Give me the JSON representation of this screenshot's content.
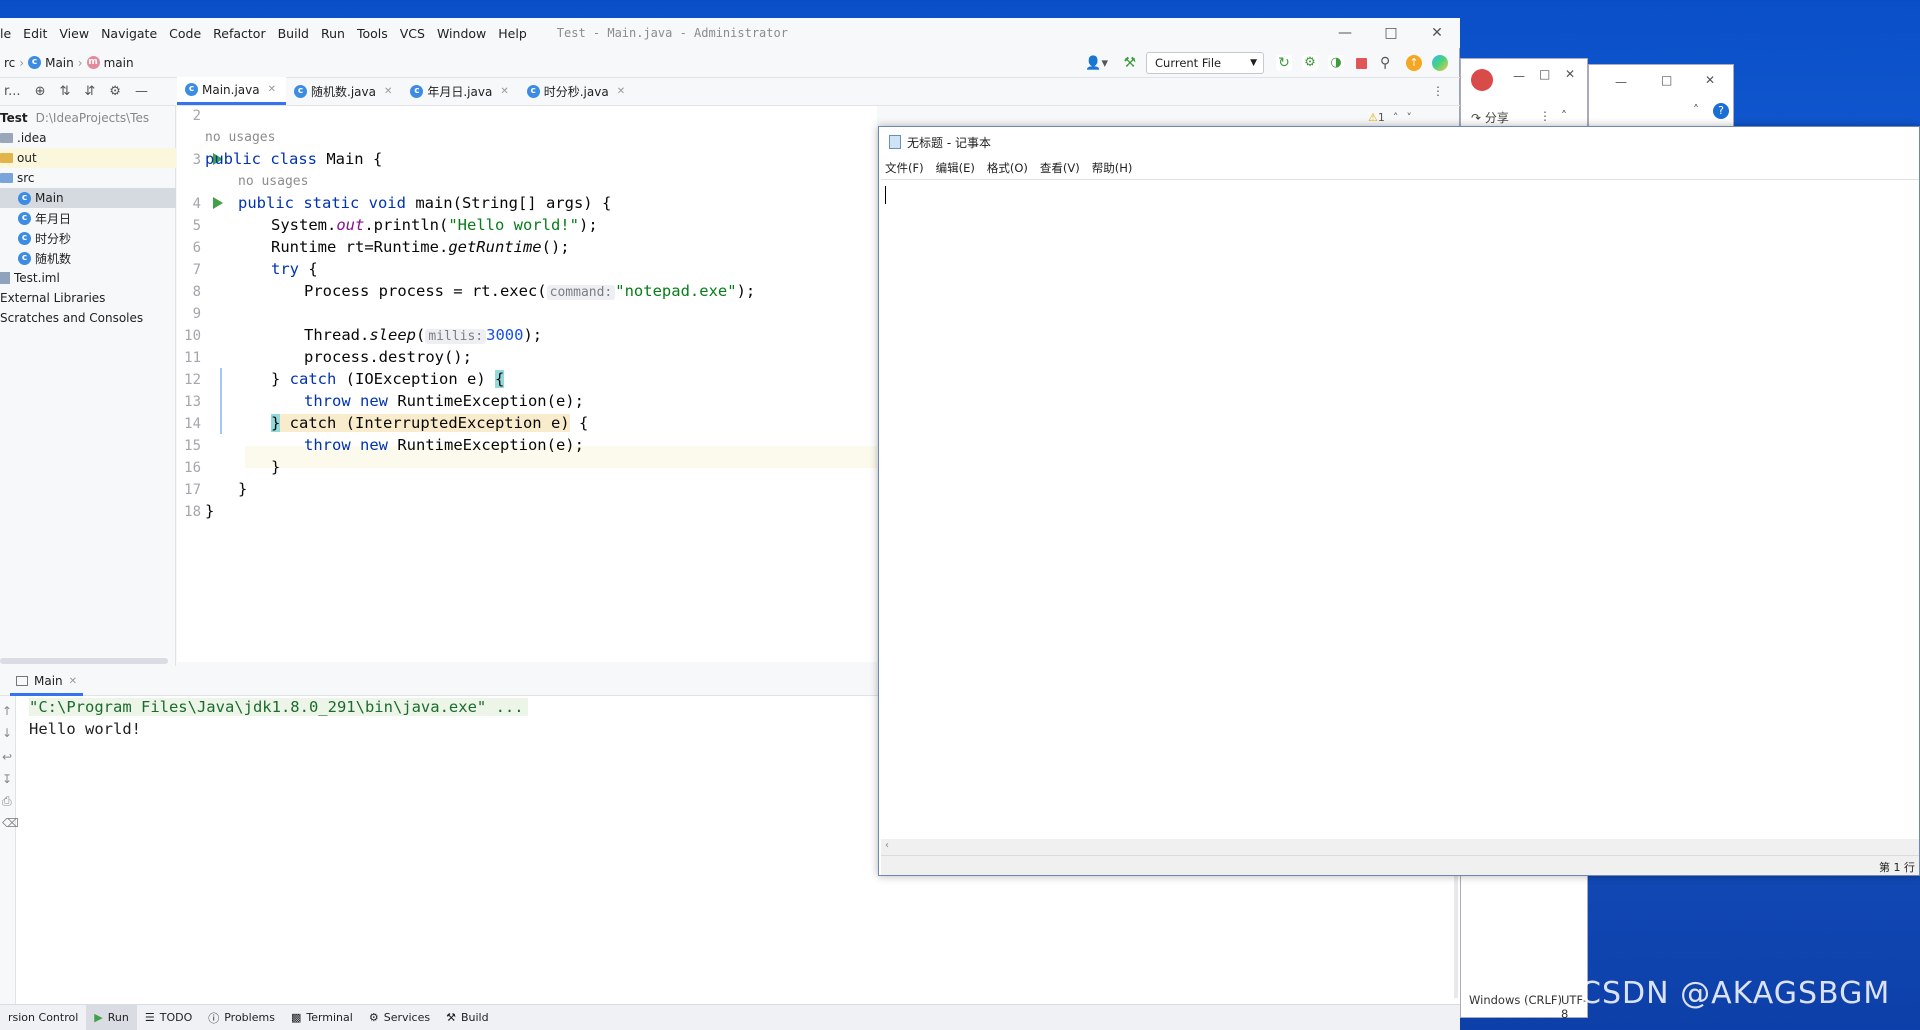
{
  "ide": {
    "menu": [
      "le",
      "Edit",
      "View",
      "Navigate",
      "Code",
      "Refactor",
      "Build",
      "Run",
      "Tools",
      "VCS",
      "Window",
      "Help"
    ],
    "window_title": "Test - Main.java - Administrator",
    "breadcrumb": [
      "rc",
      "Main",
      "main"
    ],
    "run_config": "Current File",
    "project_root": "Test",
    "project_path": "D:\\IdeaProjects\\Tes",
    "tree": [
      ".idea",
      "out",
      "src",
      "Main",
      "年月日",
      "时分秒",
      "随机数",
      "Test.iml",
      "External Libraries",
      "Scratches and Consoles"
    ],
    "tabs": [
      "Main.java",
      "随机数.java",
      "年月日.java",
      "时分秒.java"
    ],
    "warnings": "1",
    "line_numbers": [
      "2",
      "3",
      "4",
      "5",
      "6",
      "7",
      "8",
      "9",
      "10",
      "11",
      "12",
      "13",
      "14",
      "15",
      "16",
      "17",
      "18"
    ],
    "no_usages": "no usages",
    "code": {
      "l3a": "public class",
      "l3b": " Main {",
      "l4a": "public static void",
      "l4b": " main(String[] args) {",
      "l5a": "System.",
      "l5b": "out",
      "l5c": ".println(",
      "l5d": "\"Hello world!\"",
      "l5e": ");",
      "l6a": "Runtime rt=Runtime.",
      "l6b": "getRuntime",
      "l6c": "();",
      "l7a": "try",
      "l7b": " {",
      "l8a": "Process process = rt.exec(",
      "l8hint": "command:",
      "l8b": "\"notepad.exe\"",
      "l8c": ");",
      "l10a": "Thread.",
      "l10b": "sleep",
      "l10c": "(",
      "l10hint": "millis:",
      "l10d": "3000",
      "l10e": ");",
      "l11": "process.destroy();",
      "l12a": "} ",
      "l12b": "catch",
      "l12c": " (IOException e) ",
      "l12d": "{",
      "l13a": "throw new",
      "l13b": " RuntimeException(e);",
      "l14a": "}",
      "l14b": " catch (InterruptedException e)",
      "l14c": " {",
      "l15a": "throw new",
      "l15b": " RuntimeException(e);",
      "l16": "}",
      "l17": "}",
      "l18": "}"
    },
    "run_tab": "Main",
    "console": [
      "\"C:\\Program Files\\Java\\jdk1.8.0_291\\bin\\java.exe\" ...",
      "Hello world!"
    ],
    "status": [
      "rsion Control",
      "Run",
      "TODO",
      "Problems",
      "Terminal",
      "Services",
      "Build"
    ]
  },
  "bg": {
    "share": "分享",
    "encoding": "Windows (CRLF)",
    "utf": "UTF-8"
  },
  "notepad": {
    "title": "无标题 - 记事本",
    "menu": [
      "文件(F)",
      "编辑(E)",
      "格式(O)",
      "查看(V)",
      "帮助(H)"
    ],
    "status_right": "第 1 行"
  },
  "watermark": "CSDN @AKAGSBGM"
}
